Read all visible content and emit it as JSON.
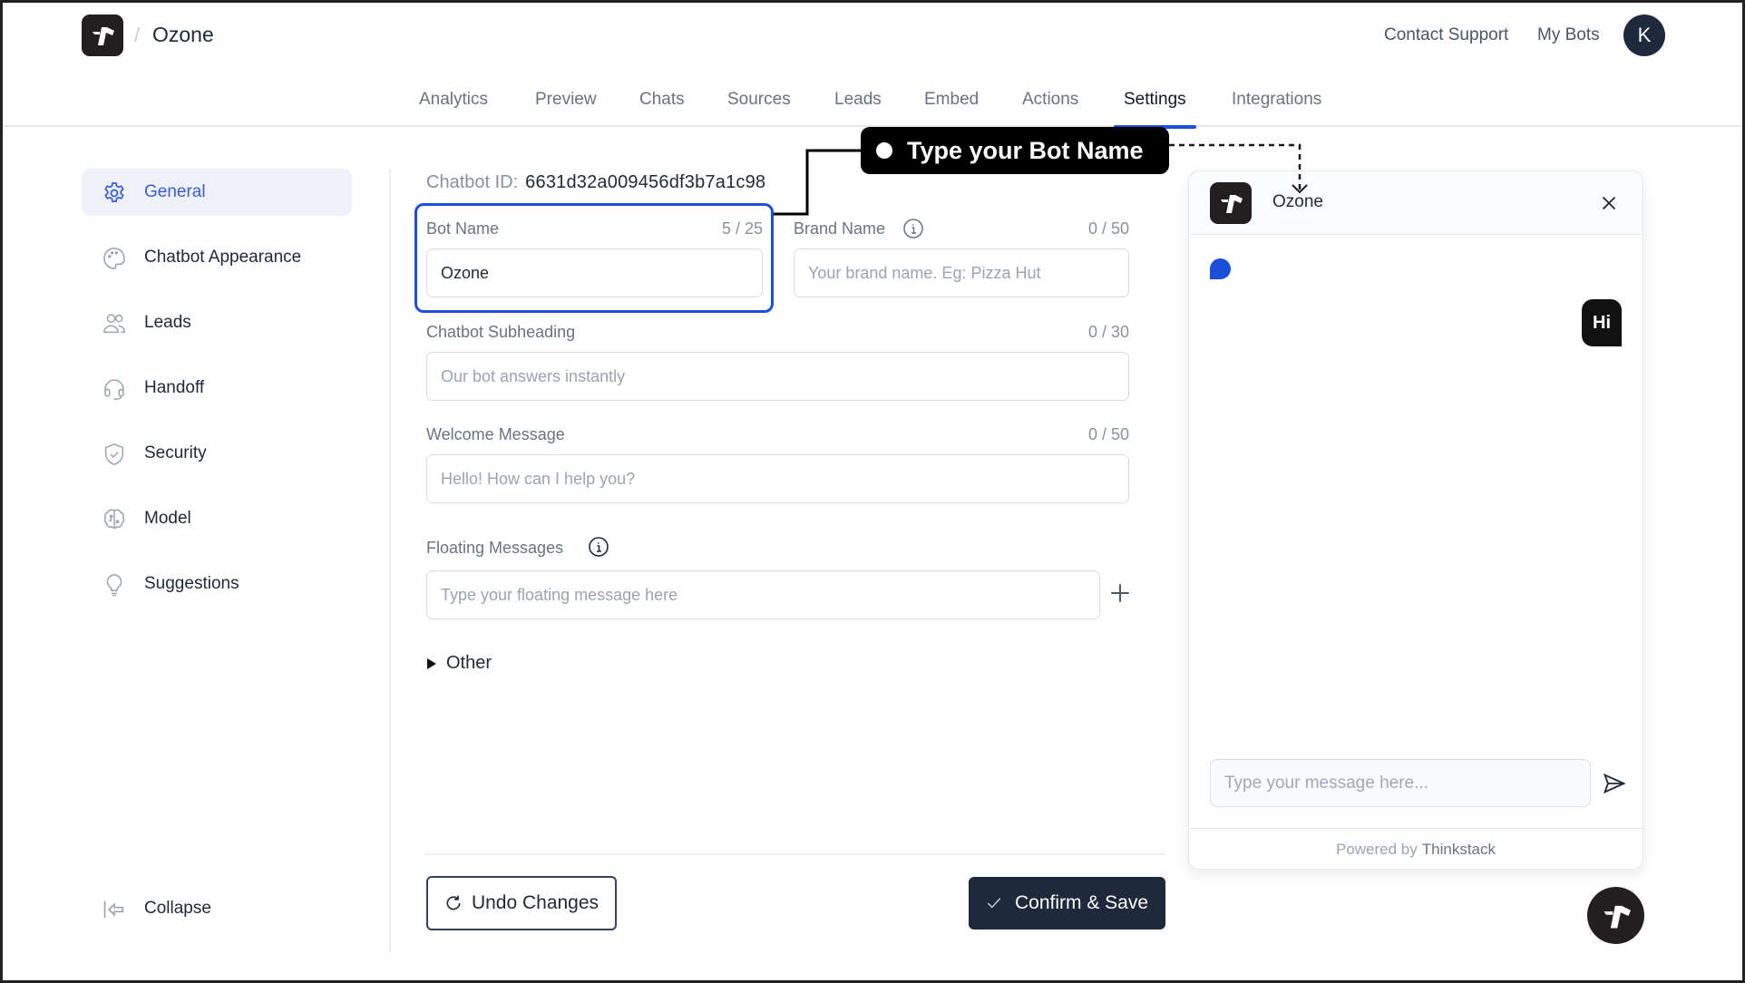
{
  "header": {
    "app_name": "Ozone",
    "breadcrumb_separator": "/",
    "links": [
      "Contact Support",
      "My Bots"
    ],
    "avatar_initial": "K",
    "logo_icon": "thinkstack-logo-icon"
  },
  "tabs": [
    {
      "label": "Analytics",
      "active": false
    },
    {
      "label": "Preview",
      "active": false
    },
    {
      "label": "Chats",
      "active": false
    },
    {
      "label": "Sources",
      "active": false
    },
    {
      "label": "Leads",
      "active": false
    },
    {
      "label": "Embed",
      "active": false
    },
    {
      "label": "Actions",
      "active": false
    },
    {
      "label": "Settings",
      "active": true
    },
    {
      "label": "Integrations",
      "active": false
    }
  ],
  "sidebar": {
    "items": [
      {
        "label": "General",
        "icon": "gear-icon",
        "active": true
      },
      {
        "label": "Chatbot Appearance",
        "icon": "palette-icon",
        "active": false
      },
      {
        "label": "Leads",
        "icon": "users-icon",
        "active": false
      },
      {
        "label": "Handoff",
        "icon": "headset-icon",
        "active": false
      },
      {
        "label": "Security",
        "icon": "shield-check-icon",
        "active": false
      },
      {
        "label": "Model",
        "icon": "brain-icon",
        "active": false
      },
      {
        "label": "Suggestions",
        "icon": "lightbulb-icon",
        "active": false
      }
    ],
    "collapse_label": "Collapse"
  },
  "form": {
    "chatbot_id_label": "Chatbot ID:",
    "chatbot_id_value": "6631d32a009456df3b7a1c98",
    "bot_name": {
      "label": "Bot Name",
      "counter": "5 / 25",
      "value": "Ozone",
      "placeholder": ""
    },
    "brand_name": {
      "label": "Brand Name",
      "counter": "0 / 50",
      "value": "",
      "placeholder": "Your brand name. Eg: Pizza Hut"
    },
    "subheading": {
      "label": "Chatbot Subheading",
      "counter": "0 / 30",
      "value": "",
      "placeholder": "Our bot answers instantly"
    },
    "welcome": {
      "label": "Welcome Message",
      "counter": "0 / 50",
      "value": "",
      "placeholder": "Hello! How can I help you?"
    },
    "floating": {
      "label": "Floating Messages",
      "value": "",
      "placeholder": "Type your floating message here"
    },
    "other_label": "Other",
    "undo_label": "Undo Changes",
    "save_label": "Confirm & Save"
  },
  "callout": {
    "text": "Type your Bot Name"
  },
  "chat_preview": {
    "title": "Ozone",
    "user_message": "Hi",
    "input_placeholder": "Type your message here...",
    "powered_by": "Powered by",
    "brand": "Thinkstack"
  },
  "colors": {
    "accent": "#1d4ed8",
    "dark": "#1e293b",
    "logo_bg": "#231f20"
  }
}
